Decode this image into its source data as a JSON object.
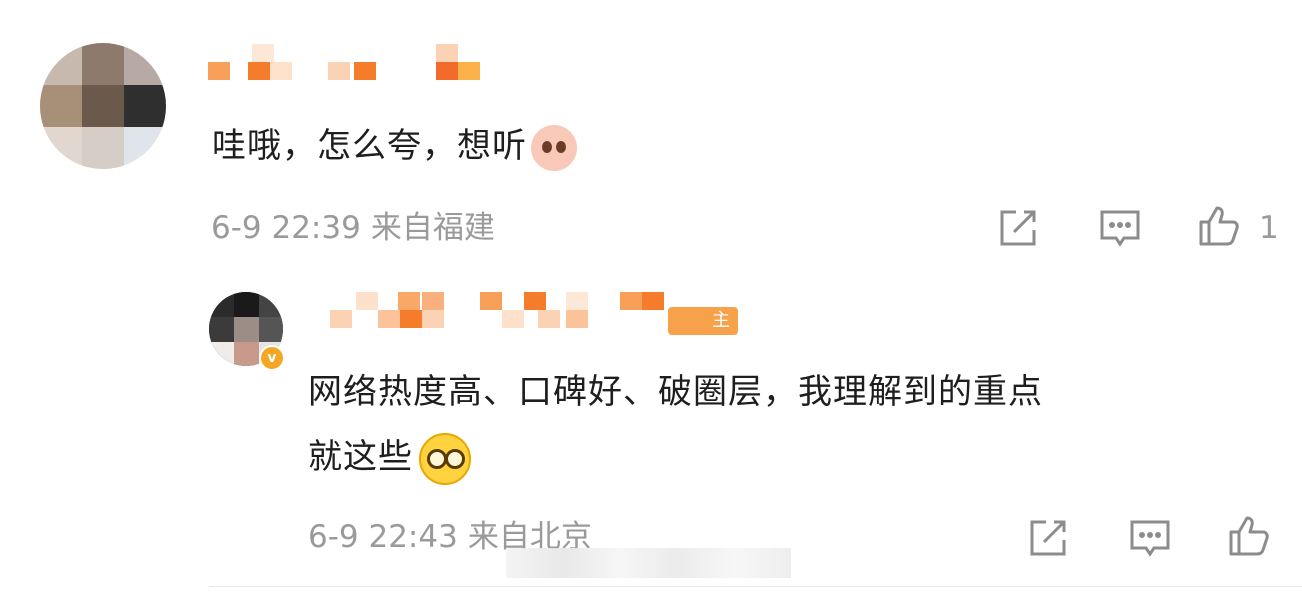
{
  "comments": [
    {
      "text": "哇哦，怎么夸，想听",
      "emoji": "shy-blush-emoji",
      "time": "6-9 22:39",
      "location": "来自福建",
      "like_count": "1",
      "user_name_redacted": true
    },
    {
      "text_line1": "网络热度高、口碑好、破圈层，我理解到的重点",
      "text_line2": "就这些",
      "emoji": "glasses-peek-emoji",
      "host_tag": "主",
      "verified_badge": "v",
      "time": "6-9 22:43",
      "location": "来自北京",
      "user_name_redacted": true
    }
  ],
  "icons": {
    "share": "share-icon",
    "comment": "comment-icon",
    "like": "thumbs-up-icon"
  },
  "colors": {
    "accent": "#f7a24a",
    "meta_gray": "#9a9a9a",
    "icon_gray": "#8c8c8c"
  }
}
